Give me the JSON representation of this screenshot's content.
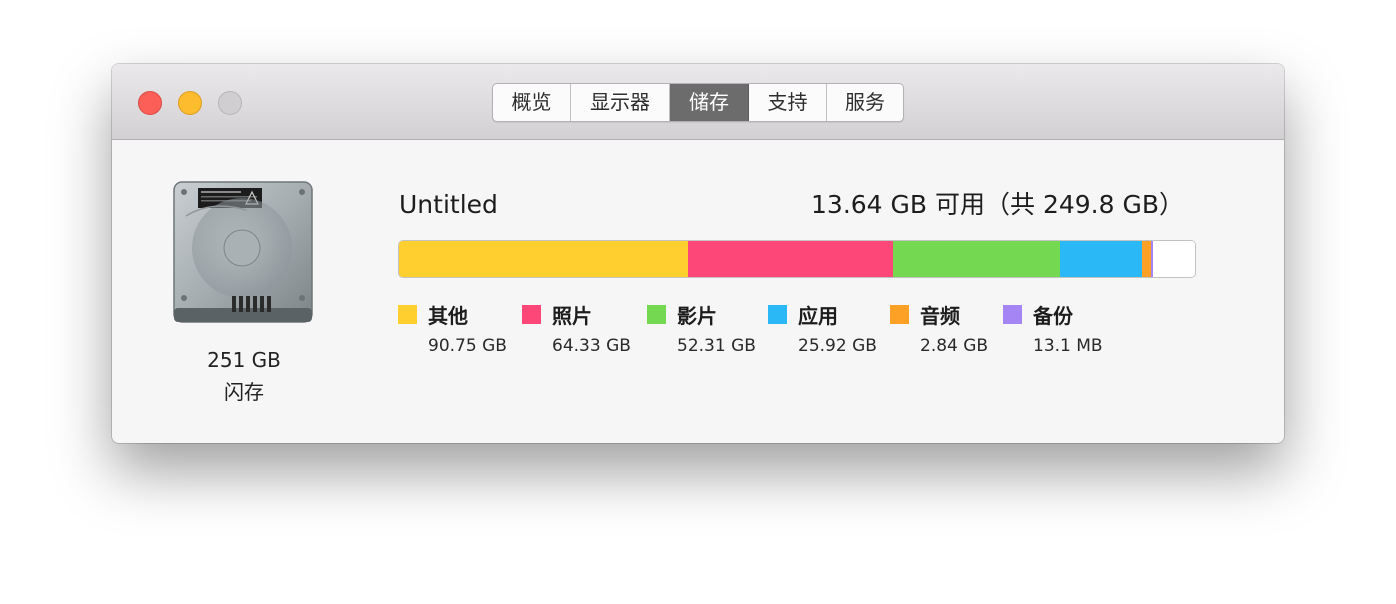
{
  "window": {
    "tabs": [
      {
        "label": "概览",
        "active": false
      },
      {
        "label": "显示器",
        "active": false
      },
      {
        "label": "储存",
        "active": true
      },
      {
        "label": "支持",
        "active": false
      },
      {
        "label": "服务",
        "active": false
      }
    ]
  },
  "disk": {
    "size": "251 GB",
    "kind": "闪存",
    "icon": "hard-drive-icon"
  },
  "volume": {
    "name": "Untitled",
    "free_text": "13.64 GB 可用（共 249.8 GB）",
    "total_gb": 249.8,
    "free_gb": 13.64
  },
  "categories": [
    {
      "label": "其他",
      "value": "90.75 GB",
      "gb": 90.75,
      "color": "#fecf2e"
    },
    {
      "label": "照片",
      "value": "64.33 GB",
      "gb": 64.33,
      "color": "#fd4778"
    },
    {
      "label": "影片",
      "value": "52.31 GB",
      "gb": 52.31,
      "color": "#74d950"
    },
    {
      "label": "应用",
      "value": "25.92 GB",
      "gb": 25.92,
      "color": "#2bb8f6"
    },
    {
      "label": "音频",
      "value": "2.84 GB",
      "gb": 2.84,
      "color": "#fca126"
    },
    {
      "label": "备份",
      "value": "13.1 MB",
      "gb": 0.0131,
      "color": "#a585f4"
    }
  ]
}
